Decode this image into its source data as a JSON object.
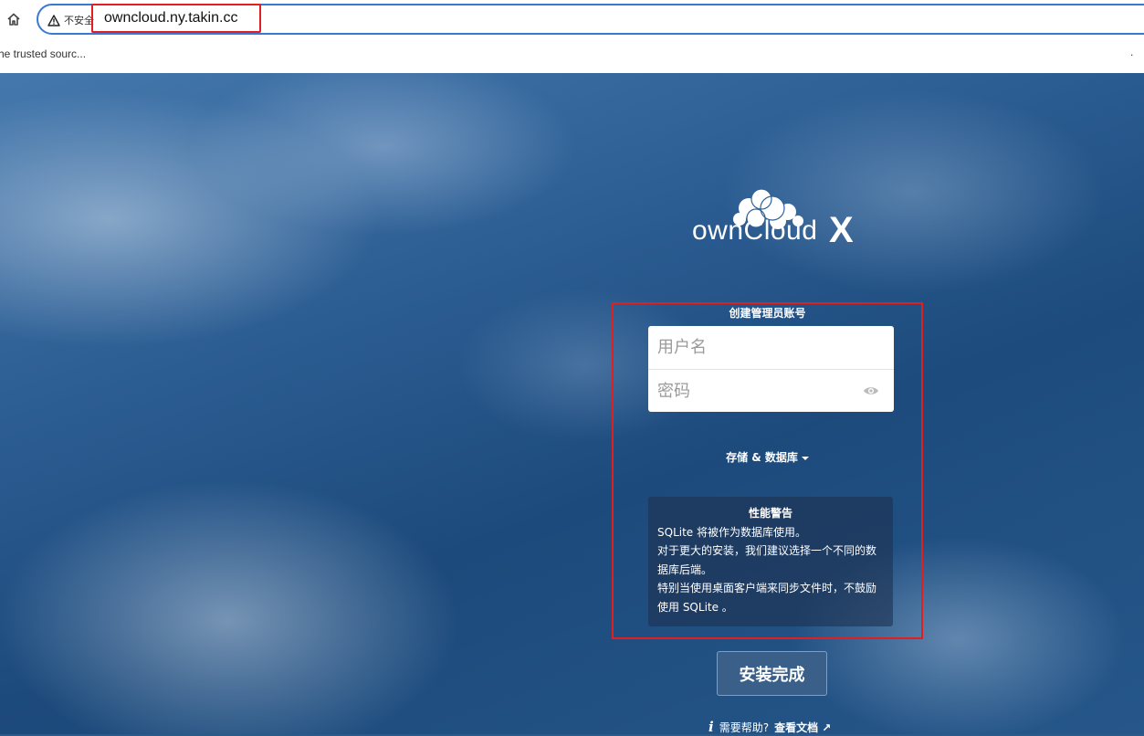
{
  "browser": {
    "security_label": "不安全",
    "url": "owncloud.ny.takin.cc",
    "bookmark_text": "he trusted sourc...",
    "bookmark_extra": "."
  },
  "logo": {
    "text": "ownCloud",
    "suffix": "X"
  },
  "form": {
    "legend": "创建管理员账号",
    "username_placeholder": "用户名",
    "password_placeholder": "密码",
    "storage_toggle": "存储 & 数据库",
    "submit_label": "安装完成"
  },
  "warning": {
    "title": "性能警告",
    "line1": "SQLite 将被作为数据库使用。",
    "line2": "对于更大的安装，我们建议选择一个不同的数据库后端。",
    "line3": "特别当使用桌面客户端来同步文件时，不鼓励使用 SQLite 。"
  },
  "help": {
    "icon": "i",
    "prompt": "需要帮助?",
    "link": "查看文档 ↗"
  },
  "colors": {
    "highlight": "#e02020",
    "omnibox_border": "#3b78d4",
    "submit_bg": "#3a5f88"
  }
}
